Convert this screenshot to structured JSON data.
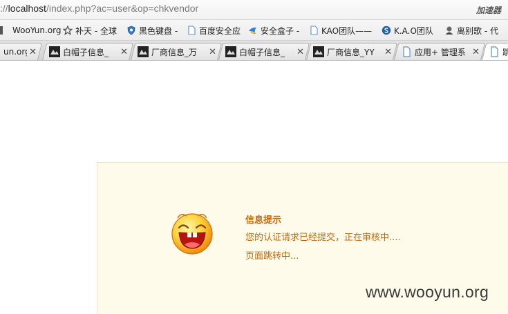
{
  "address_bar": {
    "url_prefix": "://",
    "url_host": "localhost",
    "url_path": "/index.php?ac=user&op=chkvendor",
    "accelerator_label": "加速器"
  },
  "bookmarks": [
    {
      "label": "WooYun.org",
      "icon": "wooyun-icon"
    },
    {
      "label": "补天 - 全球",
      "icon": "star-icon"
    },
    {
      "label": "黑色键盘 -",
      "icon": "shield-icon"
    },
    {
      "label": "百度安全应",
      "icon": "page-icon"
    },
    {
      "label": "安全盒子 -",
      "icon": "bird-icon"
    },
    {
      "label": "KAO团队——",
      "icon": "page-icon"
    },
    {
      "label": "K.A.O团队",
      "icon": "s-icon"
    },
    {
      "label": "离别歌 - 代",
      "icon": "avatar-icon"
    }
  ],
  "tabs": [
    {
      "label": "un.org",
      "icon": "none"
    },
    {
      "label": "白帽子信息_",
      "icon": "wooyun-icon"
    },
    {
      "label": "厂商信息_万",
      "icon": "wooyun-icon"
    },
    {
      "label": "白帽子信息_",
      "icon": "wooyun-icon"
    },
    {
      "label": "厂商信息_YY",
      "icon": "wooyun-icon"
    },
    {
      "label": "应用+ 管理系",
      "icon": "page-icon"
    },
    {
      "label": "跳",
      "icon": "page-icon"
    }
  ],
  "notice": {
    "title": "信息提示",
    "line1": "您的认证请求已经提交，正在审核中....",
    "line2": "页面跳转中...",
    "icon": "laughing-face-icon"
  },
  "watermark": "www.wooyun.org",
  "colors": {
    "notice_bg": "#fffbea",
    "notice_text": "#c16a10"
  }
}
